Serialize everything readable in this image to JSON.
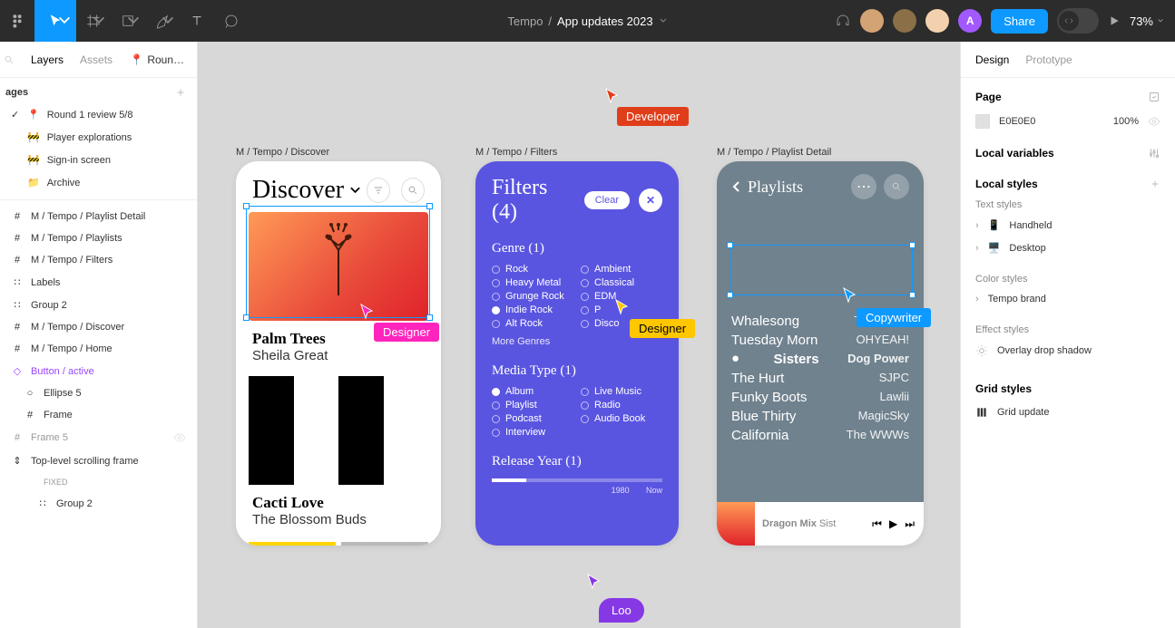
{
  "topbar": {
    "breadcrumb_root": "Tempo",
    "breadcrumb_sep": "/",
    "breadcrumb_file": "App updates 2023",
    "share": "Share",
    "zoom": "73%",
    "avatar_initial": "A"
  },
  "leftpanel": {
    "tab_layers": "Layers",
    "tab_assets": "Assets",
    "page_badge": "Roun…",
    "pages_label": "ages",
    "pages": [
      {
        "label": "Round 1 review 5/8",
        "prefix": "📍",
        "checked": true
      },
      {
        "label": "Player explorations",
        "prefix": "🚧"
      },
      {
        "label": "Sign-in screen",
        "prefix": "🚧"
      },
      {
        "label": "Archive",
        "prefix": "📁"
      }
    ],
    "layers": [
      {
        "label": "M / Tempo / Playlist Detail",
        "ico": "#",
        "bold": true
      },
      {
        "label": "M / Tempo / Playlists",
        "ico": "#",
        "bold": true
      },
      {
        "label": "M / Tempo / Filters",
        "ico": "#",
        "bold": true
      },
      {
        "label": "Labels",
        "ico": "∷"
      },
      {
        "label": "Group 2",
        "ico": "∷"
      },
      {
        "label": "M / Tempo / Discover",
        "ico": "#",
        "bold": true
      },
      {
        "label": "M / Tempo / Home",
        "ico": "#",
        "bold": true
      },
      {
        "label": "Button / active",
        "ico": "◇",
        "purple": true
      },
      {
        "label": "Ellipse 5",
        "ico": "○",
        "indent": 1
      },
      {
        "label": "Frame",
        "ico": "#",
        "indent": 1
      },
      {
        "label": "Frame 5",
        "ico": "#",
        "gray": true,
        "eye": true
      },
      {
        "label": "Top-level scrolling frame",
        "ico": "⇕",
        "bold": true
      },
      {
        "label": "FIXED",
        "ico": "",
        "gray": true,
        "indent": 1,
        "small": true
      },
      {
        "label": "Group 2",
        "ico": "∷",
        "indent": 2
      }
    ]
  },
  "rightpanel": {
    "tab_design": "Design",
    "tab_proto": "Prototype",
    "page_label": "Page",
    "bg_hex": "E0E0E0",
    "bg_pct": "100%",
    "local_vars": "Local variables",
    "local_styles": "Local styles",
    "text_styles": "Text styles",
    "ts_handheld": "Handheld",
    "ts_desktop": "Desktop",
    "color_styles": "Color styles",
    "cs_tempo": "Tempo brand",
    "effect_styles": "Effect styles",
    "es_overlay": "Overlay drop shadow",
    "grid_styles": "Grid styles",
    "gs_update": "Grid update"
  },
  "canvas": {
    "labels": {
      "f1": "M / Tempo / Discover",
      "f2": "M / Tempo / Filters",
      "f3": "M / Tempo / Playlist Detail"
    },
    "cursors": {
      "developer": "Developer",
      "designer1": "Designer",
      "designer2": "Designer",
      "copywriter": "Copywriter",
      "loo": "Loo"
    },
    "discover": {
      "title": "Discover",
      "card1_t": "Palm Trees",
      "card1_a": "Sheila Great",
      "card2_t": "Cacti Love",
      "card2_a": "The Blossom Buds"
    },
    "filters": {
      "title": "Filters (4)",
      "clear": "Clear",
      "genre_h": "Genre (1)",
      "genres_l": [
        "Rock",
        "Heavy Metal",
        "Grunge Rock",
        "Indie Rock",
        "Alt Rock"
      ],
      "genres_r": [
        "Ambient",
        "Classical",
        "EDM",
        "P",
        "Disco"
      ],
      "genre_on": "Indie Rock",
      "more": "More Genres",
      "media_h": "Media Type (1)",
      "media_l": [
        "Album",
        "Playlist",
        "Podcast",
        "Interview"
      ],
      "media_r": [
        "Live Music",
        "Radio",
        "Audio Book"
      ],
      "media_on": "Album",
      "year_h": "Release Year (1)",
      "year_from": "1980",
      "year_to": "Now"
    },
    "playlist": {
      "back": "Playlists",
      "tracks": [
        {
          "t": "Whalesong",
          "a": "The Drags"
        },
        {
          "t": "Tuesday Morn",
          "a": "OHYEAH!"
        },
        {
          "t": "Sisters",
          "a": "Dog Power",
          "cur": true
        },
        {
          "t": "The Hurt",
          "a": "SJPC"
        },
        {
          "t": "Funky Boots",
          "a": "Lawlii"
        },
        {
          "t": "Blue Thirty",
          "a": "MagicSky"
        },
        {
          "t": "California",
          "a": "The WWWs"
        }
      ],
      "now_t": "Dragon Mix",
      "now_a": "Sist"
    }
  }
}
